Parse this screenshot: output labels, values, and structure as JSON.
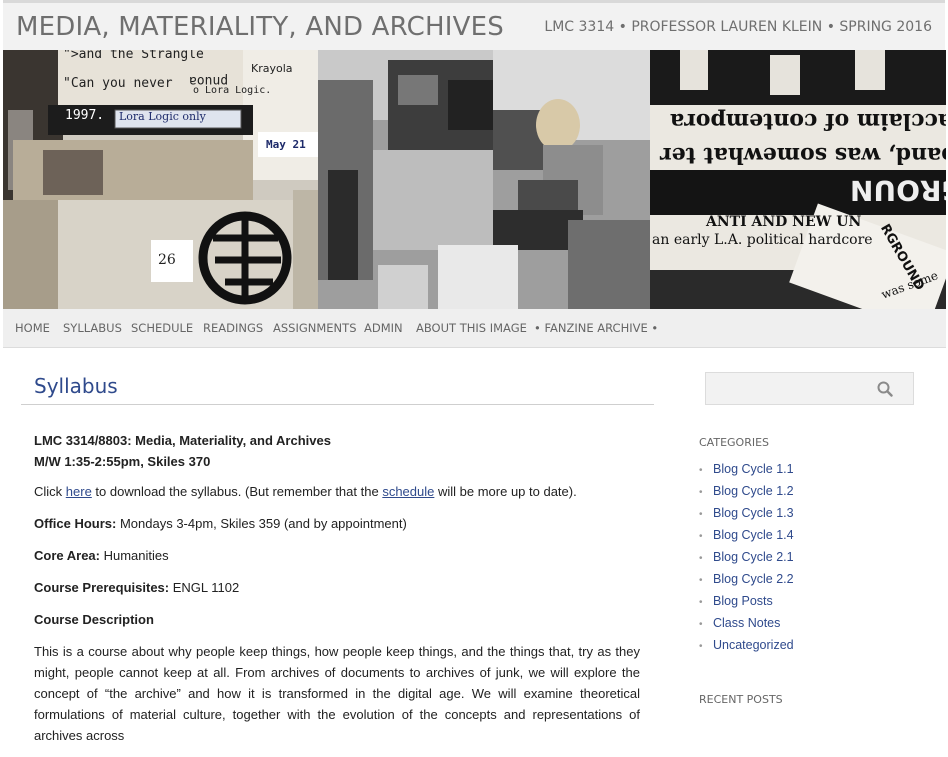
{
  "header": {
    "site_title": "MEDIA, MATERIALITY, AND ARCHIVES",
    "site_description": "LMC 3314 • PROFESSOR LAUREN KLEIN • SPRING 2016"
  },
  "banner": {
    "collage_texts": [
      "\">and the Strangle",
      "\"Can you never",
      "pnuoa",
      "o Lora Logic.",
      "1997.",
      "Lora Logic only",
      "May 21",
      "26",
      "Krayola",
      "acclaim of contempora",
      "band, was somewhat ter",
      "ERGROUN",
      "ANTI AND NEW UN",
      "an early L.A. political hardcore",
      "RGROUND",
      "was some"
    ]
  },
  "nav": {
    "items": [
      "HOME",
      "SYLLABUS",
      "SCHEDULE",
      "READINGS",
      "ASSIGNMENTS",
      "ADMIN",
      "ABOUT THIS IMAGE",
      "• FANZINE ARCHIVE •"
    ]
  },
  "main": {
    "page_title": "Syllabus",
    "course_name": "LMC 3314/8803: Media, Materiality, and Archives",
    "course_time": "M/W 1:35-2:55pm, Skiles 370",
    "download_pre": "Click ",
    "download_link": "here",
    "download_mid": " to download the syllabus. (But remember that the ",
    "schedule_link": "schedule",
    "download_post": " will be more up to date).",
    "office_label": "Office Hours:",
    "office_value": " Mondays 3-4pm, Skiles 359 (and by appointment)",
    "core_label": "Core Area:",
    "core_value": " Humanities",
    "prereq_label": "Course Prerequisites:",
    "prereq_value": " ENGL 1102",
    "description_heading": "Course Description",
    "description": "This is a course about why people keep things, how people keep things, and the things that, try as they might, people cannot keep at all. From archives of documents to archives of junk, we will explore the concept of “the archive” and how it is transformed in the digital age. We will examine theoretical formulations of material culture, together with the evolution of the concepts and representations of archives across"
  },
  "sidebar": {
    "search_placeholder": "",
    "categories_title": "CATEGORIES",
    "categories": [
      "Blog Cycle 1.1",
      "Blog Cycle 1.2",
      "Blog Cycle 1.3",
      "Blog Cycle 1.4",
      "Blog Cycle 2.1",
      "Blog Cycle 2.2",
      "Blog Posts",
      "Class Notes",
      "Uncategorized"
    ],
    "recent_posts_title": "RECENT POSTS"
  }
}
